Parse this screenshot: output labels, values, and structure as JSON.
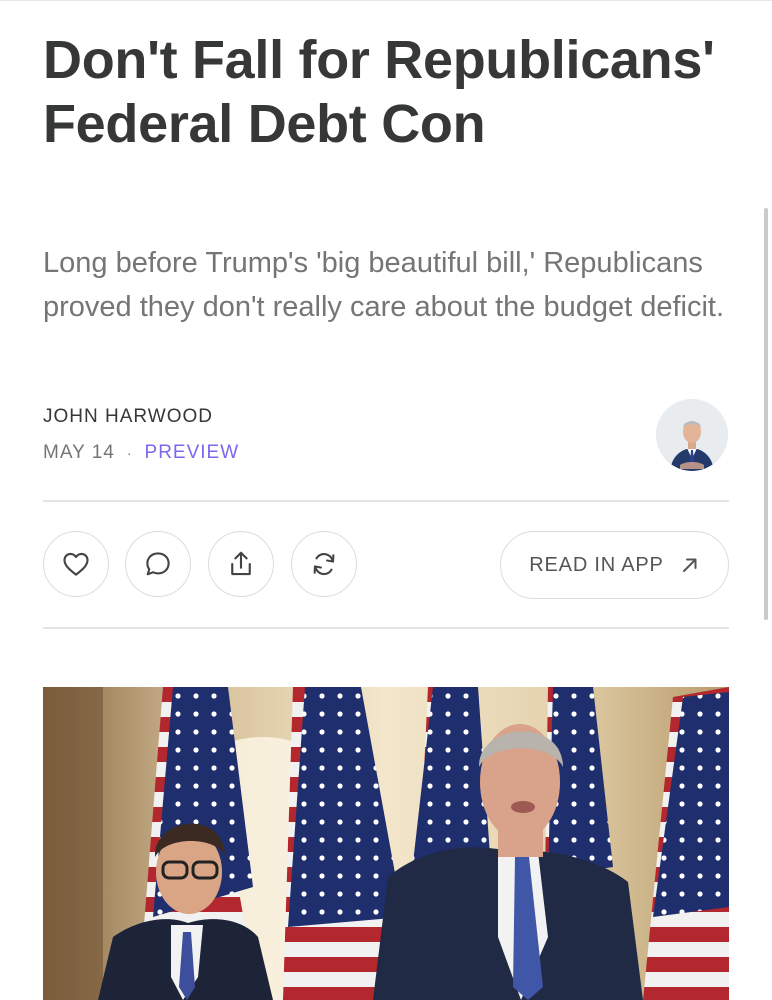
{
  "article": {
    "title": "Don't Fall for Republicans' Federal Debt Con",
    "subtitle": "Long before Trump's 'big beautiful bill,' Republicans proved they don't really care about the budget deficit.",
    "author": "JOHN HARWOOD",
    "date": "MAY 14",
    "separator": "·",
    "access_label": "PREVIEW"
  },
  "actions": {
    "like_icon": "heart-icon",
    "comment_icon": "comment-icon",
    "share_icon": "share-icon",
    "restack_icon": "restack-icon",
    "read_in_app_label": "READ IN APP",
    "read_in_app_icon": "arrow-up-right-icon"
  },
  "colors": {
    "title": "#363737",
    "subtitle": "#757575",
    "accent": "#7b68ee",
    "border": "#dcdcdc"
  }
}
